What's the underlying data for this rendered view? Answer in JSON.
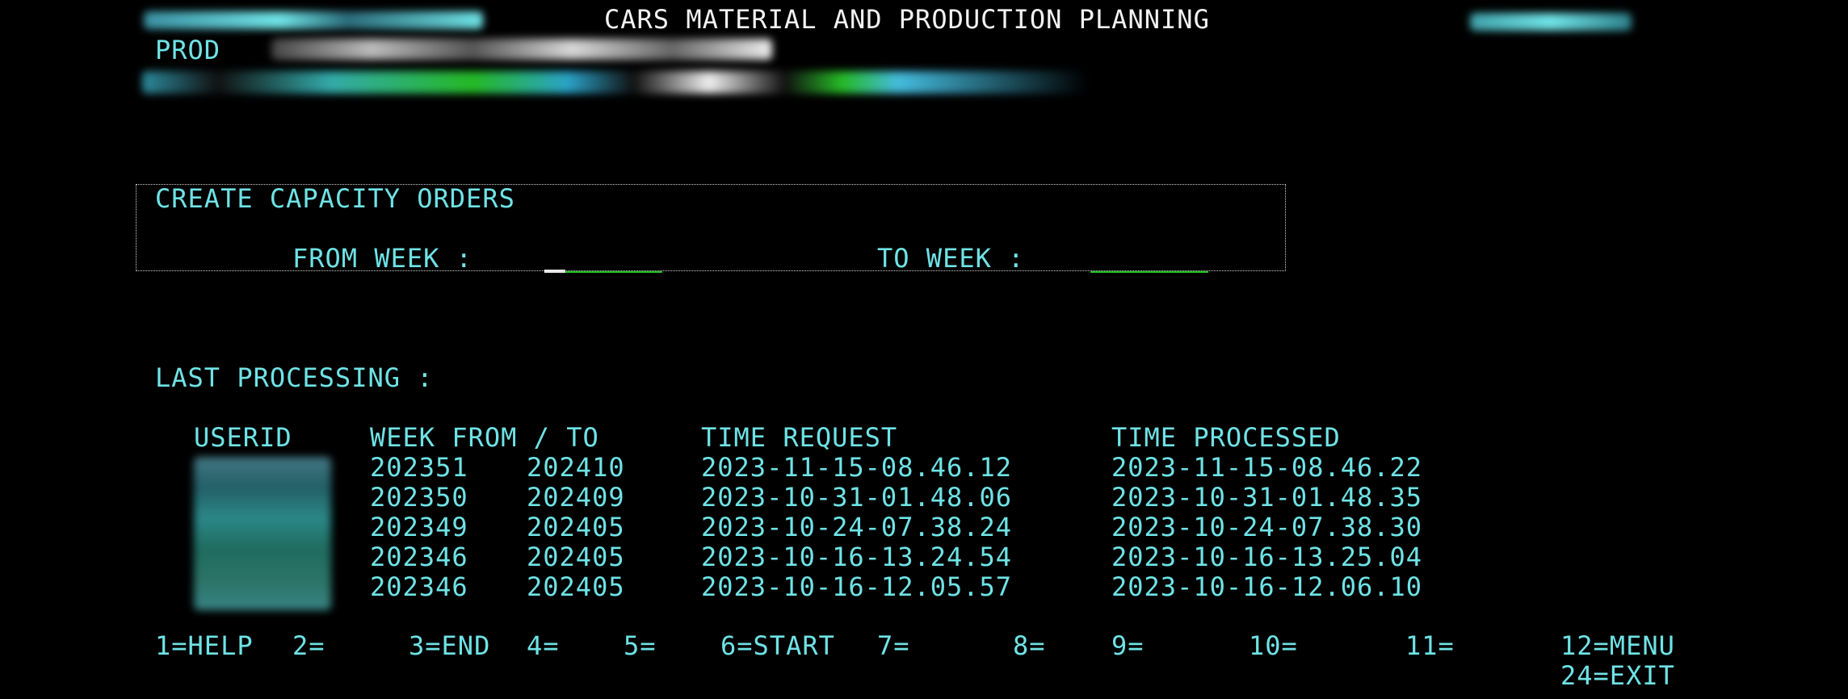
{
  "header": {
    "title": "CARS MATERIAL AND PRODUCTION PLANNING",
    "environment": "PROD"
  },
  "panel": {
    "title": "CREATE CAPACITY ORDERS",
    "from_week_label": "FROM WEEK :",
    "from_week_value": "",
    "to_week_label": "TO WEEK :",
    "to_week_value": ""
  },
  "last_processing": {
    "label": "LAST PROCESSING :",
    "columns": {
      "userid": "USERID",
      "week_range": "WEEK FROM / TO",
      "time_request": "TIME REQUEST",
      "time_processed": "TIME PROCESSED"
    },
    "rows": [
      {
        "week_from": "202351",
        "week_to": "202410",
        "time_request": "2023-11-15-08.46.12",
        "time_processed": "2023-11-15-08.46.22"
      },
      {
        "week_from": "202350",
        "week_to": "202409",
        "time_request": "2023-10-31-01.48.06",
        "time_processed": "2023-10-31-01.48.35"
      },
      {
        "week_from": "202349",
        "week_to": "202405",
        "time_request": "2023-10-24-07.38.24",
        "time_processed": "2023-10-24-07.38.30"
      },
      {
        "week_from": "202346",
        "week_to": "202405",
        "time_request": "2023-10-16-13.24.54",
        "time_processed": "2023-10-16-13.25.04"
      },
      {
        "week_from": "202346",
        "week_to": "202405",
        "time_request": "2023-10-16-12.05.57",
        "time_processed": "2023-10-16-12.06.10"
      }
    ]
  },
  "function_keys": {
    "f1": "1=HELP",
    "f2": "2=",
    "f3": "3=END",
    "f4": "4=",
    "f5": "5=",
    "f6": "6=START",
    "f7": "7=",
    "f8": "8=",
    "f9": "9=",
    "f10": "10=",
    "f11": "11=",
    "f12": "12=MENU",
    "f24": "24=EXIT"
  },
  "colors": {
    "background": "#000000",
    "text_cyan": "#6fe3e6",
    "text_white": "#f2f2f2",
    "input_green": "#22c522"
  }
}
